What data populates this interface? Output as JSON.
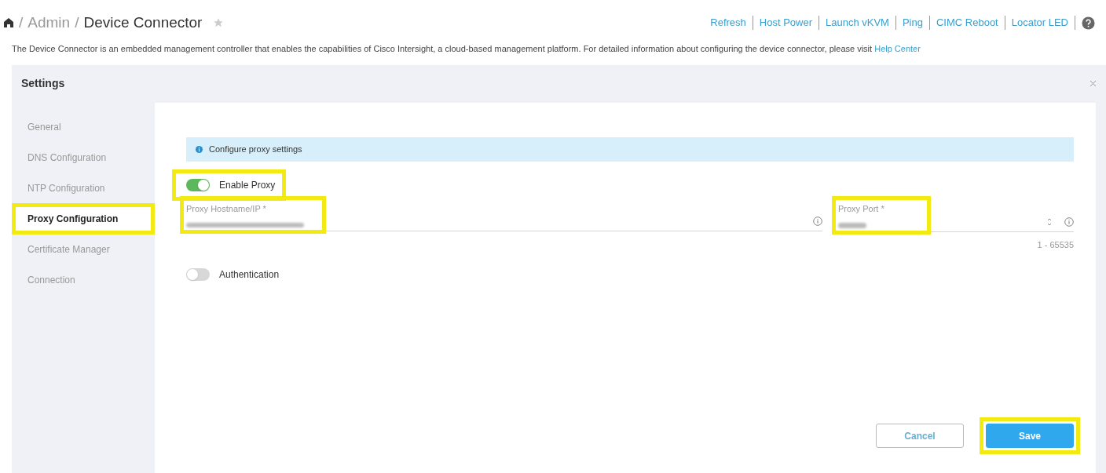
{
  "breadcrumb": {
    "items": [
      "Admin",
      "Device Connector"
    ],
    "separator": "/",
    "favorite": false
  },
  "actions": [
    "Refresh",
    "Host Power",
    "Launch vKVM",
    "Ping",
    "CIMC Reboot",
    "Locator LED"
  ],
  "description": {
    "text": "The Device Connector is an embedded management controller that enables the capabilities of Cisco Intersight, a cloud-based management platform. For detailed information about configuring the device connector, please visit",
    "link": "Help Center"
  },
  "settings": {
    "title": "Settings",
    "sidebar": [
      {
        "label": "General",
        "selected": false,
        "highlighted": false
      },
      {
        "label": "DNS Configuration",
        "selected": false,
        "highlighted": false
      },
      {
        "label": "NTP Configuration",
        "selected": false,
        "highlighted": false
      },
      {
        "label": "Proxy Configuration",
        "selected": true,
        "highlighted": true
      },
      {
        "label": "Certificate Manager",
        "selected": false,
        "highlighted": false
      },
      {
        "label": "Connection",
        "selected": false,
        "highlighted": false
      }
    ],
    "banner": "Configure proxy settings",
    "enable_proxy": {
      "label": "Enable Proxy",
      "on": true,
      "highlighted": true
    },
    "hostname": {
      "label": "Proxy Hostname/IP *",
      "highlighted": true
    },
    "port": {
      "label": "Proxy Port *",
      "hint": "1 - 65535",
      "highlighted": true
    },
    "authentication": {
      "label": "Authentication",
      "on": false
    },
    "buttons": [
      {
        "label": "Cancel",
        "kind": "secondary",
        "highlighted": false
      },
      {
        "label": "Save",
        "kind": "primary",
        "highlighted": true
      }
    ]
  }
}
